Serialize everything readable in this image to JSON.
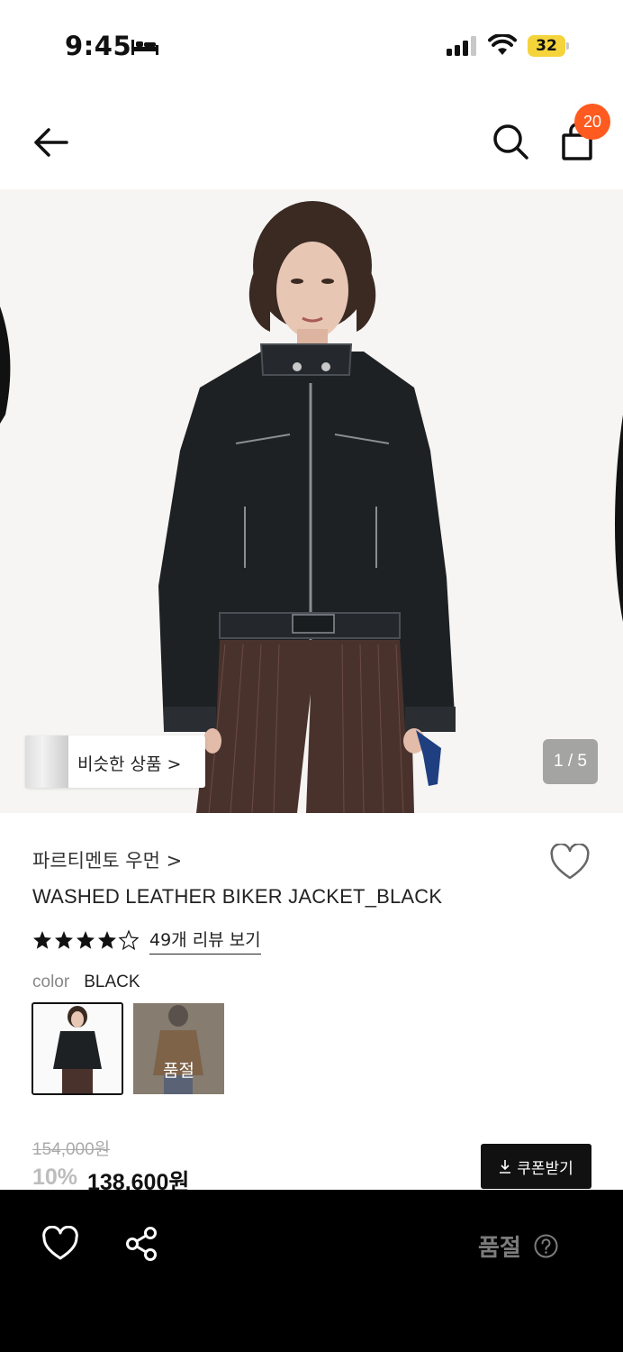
{
  "status_bar": {
    "time": "9:45",
    "battery": "32"
  },
  "header": {
    "cart_count": "20"
  },
  "hero": {
    "similar_label": "비슷한 상품 >",
    "pager": "1 / 5"
  },
  "product": {
    "brand": "파르티멘토 우먼 >",
    "title": "WASHED LEATHER BIKER JACKET_BLACK",
    "rating": 4.5,
    "reviews_label": "49개 리뷰 보기",
    "color_key": "color",
    "color_value": "BLACK",
    "swatches": [
      {
        "color": "BLACK",
        "selected": true,
        "sold_out": false
      },
      {
        "color": "BROWN",
        "selected": false,
        "sold_out": true,
        "sold_label": "품절"
      }
    ],
    "original_price": "154,000원",
    "discount": "10%",
    "price": "138,600원",
    "coupon_label": "쿠폰받기"
  },
  "bottom_bar": {
    "status": "품절"
  },
  "colors": {
    "badge": "#ff5a1f",
    "battery": "#f5d33b",
    "bar": "#000000"
  }
}
